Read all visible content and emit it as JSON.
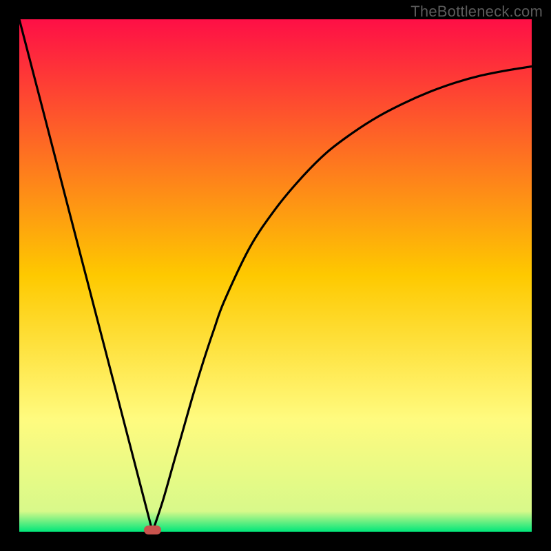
{
  "watermark": "TheBottleneck.com",
  "colors": {
    "top": "#fe0f46",
    "mid": "#fec900",
    "low": "#fffb7f",
    "bottom": "#00e67a",
    "curve": "#000000",
    "frame": "#000000",
    "marker": "#c9534d"
  },
  "chart_data": {
    "type": "line",
    "title": "",
    "xlabel": "",
    "ylabel": "",
    "xlim": [
      0,
      1
    ],
    "ylim": [
      0,
      1
    ],
    "series": [
      {
        "name": "left-branch",
        "x": [
          0.0,
          0.05,
          0.1,
          0.15,
          0.2,
          0.24,
          0.26
        ],
        "y": [
          1.0,
          0.808,
          0.615,
          0.423,
          0.231,
          0.077,
          0.0
        ]
      },
      {
        "name": "right-branch",
        "x": [
          0.26,
          0.28,
          0.3,
          0.32,
          0.34,
          0.36,
          0.38,
          0.4,
          0.45,
          0.5,
          0.55,
          0.6,
          0.65,
          0.7,
          0.75,
          0.8,
          0.85,
          0.9,
          0.95,
          1.0
        ],
        "y": [
          0.0,
          0.06,
          0.13,
          0.2,
          0.27,
          0.335,
          0.395,
          0.45,
          0.555,
          0.63,
          0.69,
          0.74,
          0.778,
          0.81,
          0.836,
          0.858,
          0.876,
          0.89,
          0.9,
          0.908
        ]
      }
    ],
    "annotations": [
      {
        "name": "marker",
        "x": 0.26,
        "y": 0.0,
        "shape": "rounded-rect",
        "color": "#c9534d"
      }
    ],
    "gradient_stops": [
      {
        "offset": 0.0,
        "color": "#fe0f46"
      },
      {
        "offset": 0.5,
        "color": "#fec900"
      },
      {
        "offset": 0.78,
        "color": "#fffb7f"
      },
      {
        "offset": 0.96,
        "color": "#d8f98a"
      },
      {
        "offset": 1.0,
        "color": "#00e67a"
      }
    ]
  }
}
